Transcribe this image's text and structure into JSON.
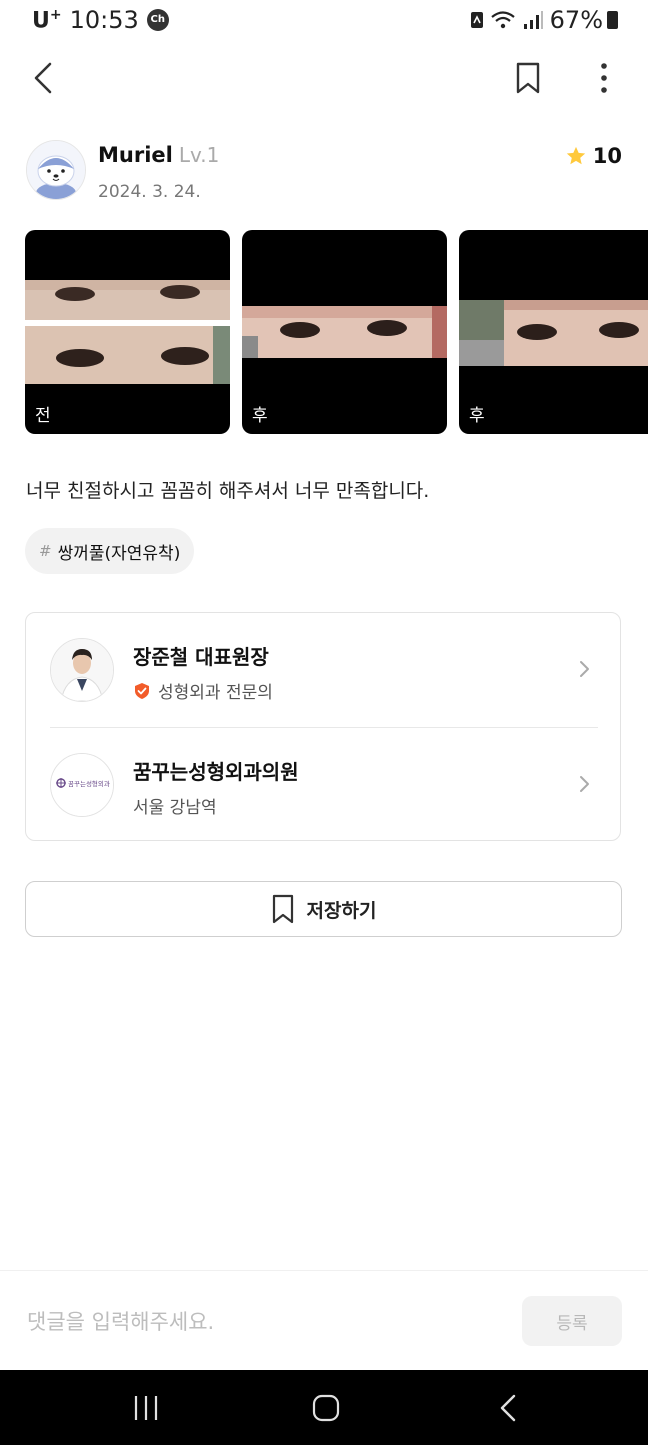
{
  "status_bar": {
    "carrier": "U",
    "carrier_sup": "+",
    "time": "10:53",
    "chat_badge": "Ch",
    "battery": "67%"
  },
  "review": {
    "author": "Muriel",
    "level": "Lv.1",
    "date": "2024. 3. 24.",
    "rating": "10",
    "photos": [
      {
        "tag": "전"
      },
      {
        "tag": "후"
      },
      {
        "tag": "후"
      }
    ],
    "text": "너무 친절하시고 꼼꼼히 해주셔서 너무 만족합니다.",
    "hashtag_symbol": "#",
    "hashtag": "쌍꺼풀(자연유착)"
  },
  "doctor": {
    "name": "장준철 대표원장",
    "specialty": "성형외과 전문의"
  },
  "clinic": {
    "name": "꿈꾸는성형외과의원",
    "location": "서울 강남역",
    "logo_text": "꿈꾸는성형외과"
  },
  "save_button": {
    "label": "저장하기"
  },
  "comment": {
    "placeholder": "댓글을 입력해주세요.",
    "submit_label": "등록"
  },
  "colors": {
    "star": "#FFC93C",
    "verified": "#F25C2A",
    "accent_text": "#111111"
  }
}
